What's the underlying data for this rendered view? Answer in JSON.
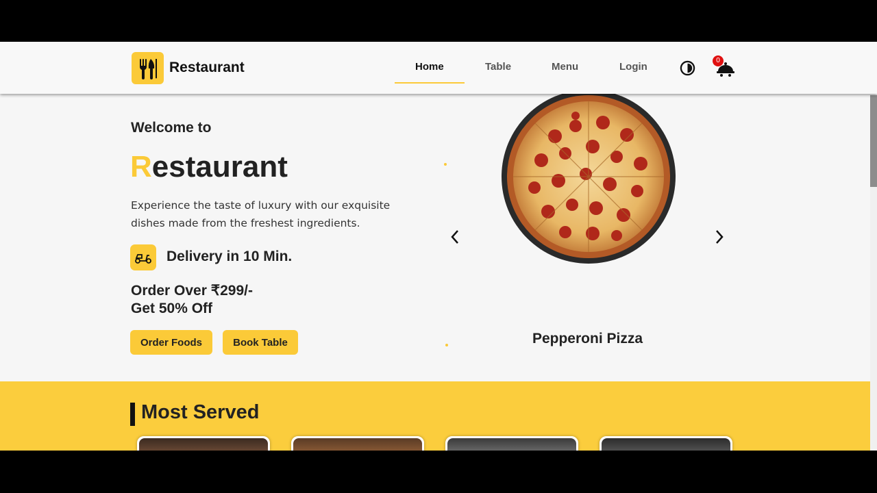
{
  "nav": {
    "brand": "Restaurant",
    "links": [
      "Home",
      "Table",
      "Menu",
      "Login"
    ],
    "active": "Home",
    "cart_count": "0"
  },
  "hero": {
    "welcome": "Welcome to",
    "title_first_letter": "R",
    "title_rest": "estaurant",
    "description": "Experience the taste of luxury with our exquisite dishes made from the freshest ingredients.",
    "delivery": "Delivery in 10 Min.",
    "offer_line1": "Order Over ₹299/-",
    "offer_line2": "Get 50% Off",
    "buttons": [
      "Order Foods",
      "Book Table"
    ],
    "carousel_item": "Pepperoni Pizza"
  },
  "most_served": {
    "title": "Most Served"
  },
  "colors": {
    "accent": "#fbca38",
    "section_bg": "#fbcd3d",
    "badge": "#e01010"
  },
  "icons": [
    "fork-knife-icon",
    "theme-toggle-icon",
    "cart-icon",
    "scooter-icon",
    "chevron-left-icon",
    "chevron-right-icon"
  ]
}
